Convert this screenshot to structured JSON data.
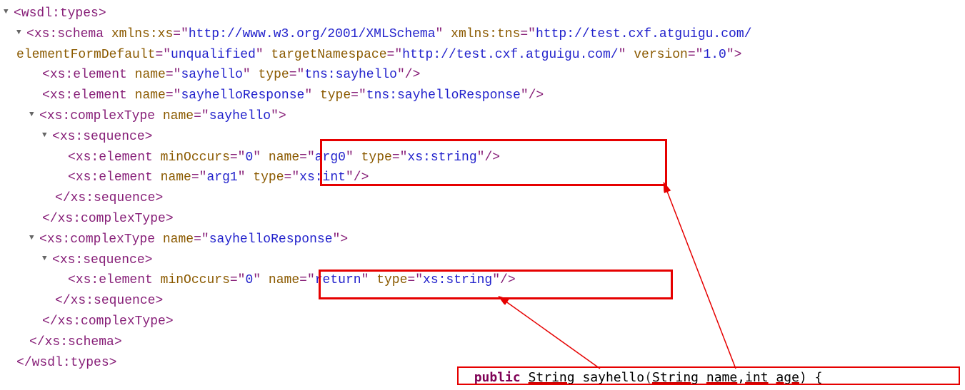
{
  "lines": {
    "l1_tag": "wsdl:types",
    "l2_tag": "xs:schema",
    "l2_a1n": "xmlns:xs",
    "l2_a1v": "http://www.w3.org/2001/XMLSchema",
    "l2_a2n": "xmlns:tns",
    "l2_a2v": "http://test.cxf.atguigu.com/",
    "l2_a3n": "elementFormDefault",
    "l2_a3v": "unqualified",
    "l2_a4n": "targetNamespace",
    "l2_a4v": "http://test.cxf.atguigu.com/",
    "l2_a5n": "version",
    "l2_a5v": "1.0",
    "l3_tag": "xs:element",
    "l3_a1n": "name",
    "l3_a1v": "sayhello",
    "l3_a2n": "type",
    "l3_a2v": "tns:sayhello",
    "l4_tag": "xs:element",
    "l4_a1n": "name",
    "l4_a1v": "sayhelloResponse",
    "l4_a2n": "type",
    "l4_a2v": "tns:sayhelloResponse",
    "l5_tag": "xs:complexType",
    "l5_a1n": "name",
    "l5_a1v": "sayhello",
    "l6_tag": "xs:sequence",
    "l7_tag": "xs:element",
    "l7_a1n": "minOccurs",
    "l7_a1v": "0",
    "l7_a2n": "name",
    "l7_a2v": "arg0",
    "l7_a3n": "type",
    "l7_a3v": "xs:string",
    "l8_tag": "xs:element",
    "l8_a1n": "name",
    "l8_a1v": "arg1",
    "l8_a2n": "type",
    "l8_a2v": "xs:int",
    "l9_tag": "/xs:sequence",
    "l10_tag": "/xs:complexType",
    "l11_tag": "xs:complexType",
    "l11_a1n": "name",
    "l11_a1v": "sayhelloResponse",
    "l12_tag": "xs:sequence",
    "l13_tag": "xs:element",
    "l13_a1n": "minOccurs",
    "l13_a1v": "0",
    "l13_a2n": "name",
    "l13_a2v": "return",
    "l13_a3n": "type",
    "l13_a3v": "xs:string",
    "l14_tag": "/xs:sequence",
    "l15_tag": "/xs:complexType",
    "l16_tag": "/xs:schema",
    "l17_tag": "/wsdl:types"
  },
  "java": {
    "kw_public": "public",
    "ret": "String",
    "method": "sayhello",
    "p1t": "String",
    "p1n": "name",
    "sep": ",",
    "p2t": "int",
    "p2n": "age",
    "brace": ") {"
  },
  "chart_data": {
    "type": "table",
    "description": "WSDL XML schema definition snippet with annotations mapping schema elements to a Java method signature",
    "xml_structure": {
      "wsdl:types": {
        "xs:schema": {
          "attributes": {
            "xmlns:xs": "http://www.w3.org/2001/XMLSchema",
            "xmlns:tns": "http://test.cxf.atguigu.com/",
            "elementFormDefault": "unqualified",
            "targetNamespace": "http://test.cxf.atguigu.com/",
            "version": "1.0"
          },
          "elements": [
            {
              "tag": "xs:element",
              "name": "sayhello",
              "type": "tns:sayhello"
            },
            {
              "tag": "xs:element",
              "name": "sayhelloResponse",
              "type": "tns:sayhelloResponse"
            }
          ],
          "complexTypes": [
            {
              "name": "sayhello",
              "sequence": [
                {
                  "tag": "xs:element",
                  "minOccurs": "0",
                  "name": "arg0",
                  "type": "xs:string"
                },
                {
                  "tag": "xs:element",
                  "name": "arg1",
                  "type": "xs:int"
                }
              ]
            },
            {
              "name": "sayhelloResponse",
              "sequence": [
                {
                  "tag": "xs:element",
                  "minOccurs": "0",
                  "name": "return",
                  "type": "xs:string"
                }
              ]
            }
          ]
        }
      }
    },
    "java_signature": "public String sayhello(String name,int age) {",
    "annotations": [
      {
        "from": "java parameters String name,int age",
        "to": "sayhello complexType sequence (arg0:xs:string, arg1:xs:int)"
      },
      {
        "from": "java return type String",
        "to": "sayhelloResponse complexType sequence return:xs:string"
      }
    ]
  }
}
